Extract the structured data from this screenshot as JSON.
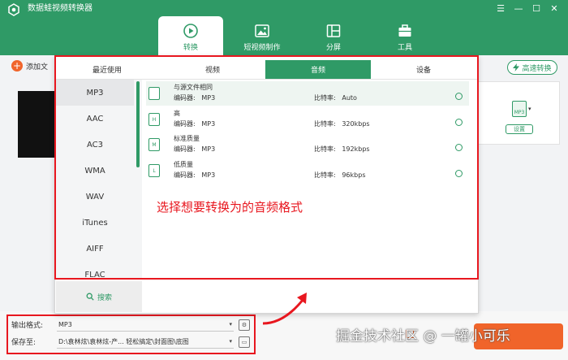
{
  "app": {
    "title": "数据蛙视频转换器",
    "window_controls": [
      "☰",
      "—",
      "☐",
      "✕"
    ]
  },
  "top_tabs": [
    {
      "label": "转换",
      "icon": "convert-icon",
      "active": true
    },
    {
      "label": "短视频制作",
      "icon": "image-icon",
      "active": false
    },
    {
      "label": "分屏",
      "icon": "split-screen-icon",
      "active": false
    },
    {
      "label": "工具",
      "icon": "toolbox-icon",
      "active": false
    }
  ],
  "toolbar": {
    "add_file_label": "添加文",
    "speed_convert_label": "高速转换"
  },
  "file_card": {
    "format_badge": "MP3",
    "settings_label": "设置"
  },
  "format_panel": {
    "tabs": [
      {
        "label": "最近使用",
        "active": false
      },
      {
        "label": "视频",
        "active": false
      },
      {
        "label": "音频",
        "active": true
      },
      {
        "label": "设备",
        "active": false
      }
    ],
    "formats": [
      "MP3",
      "AAC",
      "AC3",
      "WMA",
      "WAV",
      "iTunes",
      "AIFF",
      "FLAC"
    ],
    "selected_format": "MP3",
    "search_label": "搜索",
    "qualities": [
      {
        "name": "与源文件相同",
        "encoder_label": "编码器:",
        "encoder": "MP3",
        "bitrate_label": "比特率:",
        "bitrate": "Auto",
        "icon_text": "",
        "active": true
      },
      {
        "name": "高",
        "encoder_label": "编码器:",
        "encoder": "MP3",
        "bitrate_label": "比特率:",
        "bitrate": "320kbps",
        "icon_text": "H",
        "active": false
      },
      {
        "name": "标准质量",
        "encoder_label": "编码器:",
        "encoder": "MP3",
        "bitrate_label": "比特率:",
        "bitrate": "192kbps",
        "icon_text": "M",
        "active": false
      },
      {
        "name": "低质量",
        "encoder_label": "编码器:",
        "encoder": "MP3",
        "bitrate_label": "比特率:",
        "bitrate": "96kbps",
        "icon_text": "L",
        "active": false
      }
    ]
  },
  "annotation": {
    "text": "选择想要转换为的音频格式"
  },
  "output": {
    "format_label": "输出格式:",
    "format_value": "MP3",
    "save_label": "保存至:",
    "save_path": "D:\\袁林炫\\袁林炫-产...  轻松搞定\\封面图\\底图"
  },
  "watermark": "掘金技术社区 @ 一罐小可乐",
  "colors": {
    "brand_green": "#2f9a66",
    "annotation_red": "#e8171f",
    "accent_orange": "#f0642a"
  }
}
